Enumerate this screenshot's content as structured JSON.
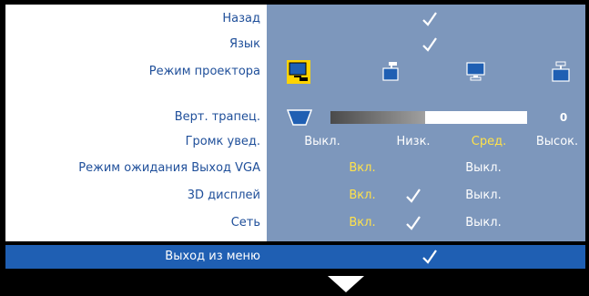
{
  "colors": {
    "label_text": "#1f4f9a",
    "value_text": "#ffffff",
    "selected_value": "#ffe24a",
    "value_area_bg": "#7d97bc",
    "highlight_bar": "#1f5fb3"
  },
  "rows": {
    "back": {
      "label": "Назад"
    },
    "language": {
      "label": "Язык"
    },
    "projector_mode": {
      "label": "Режим проектора",
      "icons": [
        "front-desktop-icon",
        "front-ceiling-icon",
        "rear-desktop-icon",
        "rear-ceiling-icon"
      ],
      "selected_index": 0
    },
    "keystone": {
      "label": "Верт. трапец.",
      "value": "0",
      "level": 0.48
    },
    "volume": {
      "label": "Громк увед.",
      "options": [
        "Выкл.",
        "Низк.",
        "Сред.",
        "Высок."
      ],
      "selected": "Сред."
    },
    "vga_standby": {
      "label": "Режим ожидания Выход VGA",
      "on": "Вкл.",
      "off": "Выкл.",
      "selected": "Вкл."
    },
    "display_3d": {
      "label": "3D дисплей",
      "on": "Вкл.",
      "off": "Выкл.",
      "selected": "Вкл."
    },
    "network": {
      "label": "Сеть",
      "on": "Вкл.",
      "off": "Выкл.",
      "selected": "Вкл."
    }
  },
  "exit": {
    "label": "Выход из меню"
  },
  "icons": {
    "check": "checkmark-icon",
    "more": "down-arrow-icon",
    "keystone": "trapezoid-icon"
  }
}
